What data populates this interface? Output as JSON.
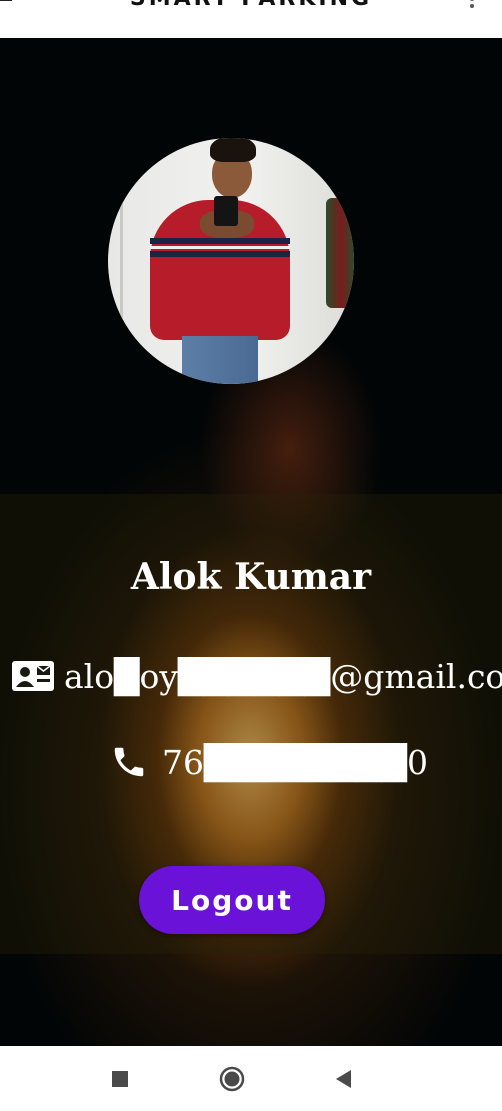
{
  "app_bar": {
    "title": "SMART PARKING",
    "menu_icon": "hamburger-menu-icon",
    "overflow_icon": "more-vert-icon"
  },
  "profile": {
    "photo_description": "user profile photo",
    "name": "Alok Kumar",
    "email": "alo█oy██████@gmail.com",
    "email_icon": "contact-card-icon",
    "phone": "76████████0",
    "phone_icon": "phone-icon"
  },
  "actions": {
    "logout_label": "Logout"
  },
  "system_nav": {
    "recents_icon": "square-recents-icon",
    "home_icon": "circle-home-icon",
    "back_icon": "triangle-back-icon"
  },
  "colors": {
    "button_bg": "#6a12d8",
    "text": "#ffffff",
    "bars": "#ffffff"
  }
}
